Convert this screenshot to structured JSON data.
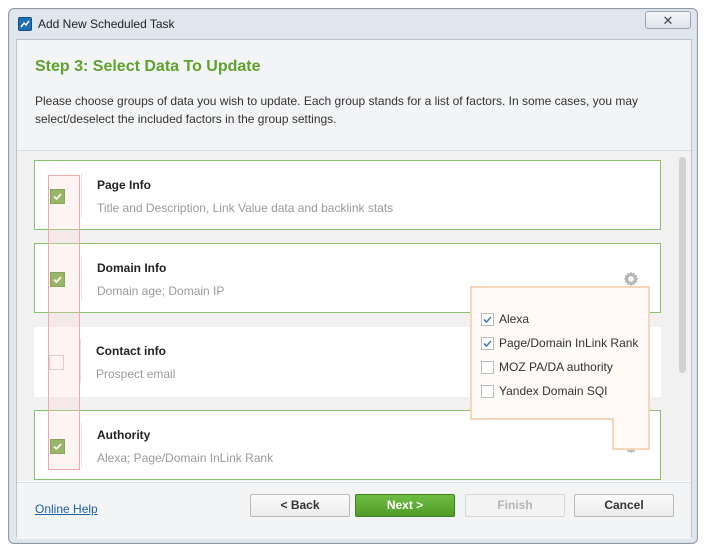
{
  "window": {
    "title": "Add New Scheduled Task",
    "close_label": "✕"
  },
  "header": {
    "step_title": "Step 3: Select Data To Update",
    "description": "Please choose groups of data you wish to update. Each group stands for a list of factors. In some cases, you may select/deselect the included factors in the group settings."
  },
  "groups": [
    {
      "name": "Page Info",
      "subtitle": "Title and Description, Link Value data and backlink stats",
      "checked": true,
      "has_settings": false
    },
    {
      "name": "Domain Info",
      "subtitle": "Domain age; Domain IP",
      "checked": true,
      "has_settings": true
    },
    {
      "name": "Contact info",
      "subtitle": "Prospect email",
      "checked": false,
      "has_settings": false
    },
    {
      "name": "Authority",
      "subtitle": "Alexa; Page/Domain InLink Rank",
      "checked": true,
      "has_settings": true
    }
  ],
  "settings_popup": {
    "options": [
      {
        "label": "Alexa",
        "checked": true
      },
      {
        "label": "Page/Domain InLink Rank",
        "checked": true
      },
      {
        "label": "MOZ PA/DA authority",
        "checked": false
      },
      {
        "label": "Yandex Domain SQI",
        "checked": false
      }
    ]
  },
  "footer": {
    "help_link": "Online Help",
    "back_label": "< Back",
    "next_label": "Next >",
    "finish_label": "Finish",
    "cancel_label": "Cancel"
  },
  "colors": {
    "accent_green": "#5fa12d",
    "check_green": "#74ad45",
    "link_blue": "#1f5fa8"
  },
  "icons": [
    "app-icon",
    "close-icon",
    "check-icon",
    "gear-icon"
  ]
}
